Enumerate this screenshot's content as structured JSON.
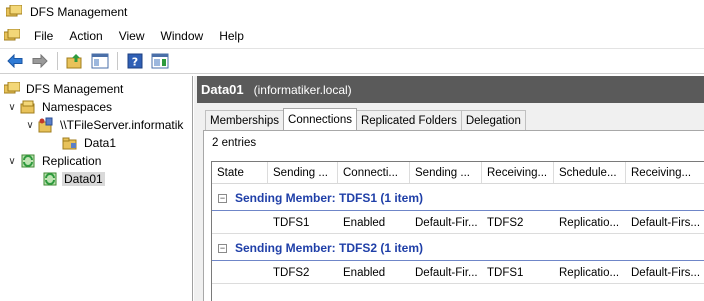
{
  "window": {
    "title": "DFS Management"
  },
  "menu": {
    "items": [
      "File",
      "Action",
      "View",
      "Window",
      "Help"
    ]
  },
  "toolbar": {
    "buttons": [
      "back-arrow-icon",
      "forward-arrow-icon",
      "up-folder-icon",
      "show-hide-tree-icon",
      "help-icon",
      "action-pane-icon"
    ]
  },
  "tree": {
    "root": "DFS Management",
    "namespaces": "Namespaces",
    "namespace_server": "\\\\TFileServer.informatik",
    "namespace_folder": "Data1",
    "replication": "Replication",
    "replication_group": "Data01"
  },
  "details": {
    "header_node": "Data01",
    "header_domain": "(informatiker.local)",
    "tabs": [
      "Memberships",
      "Connections",
      "Replicated Folders",
      "Delegation"
    ],
    "active_tab": "Connections",
    "entries": "2 entries",
    "columns": [
      "State",
      "Sending ...",
      "Connecti...",
      "Sending ...",
      "Receiving...",
      "Schedule...",
      "Receiving..."
    ],
    "groups": [
      {
        "title": "Sending Member: TDFS1 (1 item)",
        "rows": [
          [
            "",
            "TDFS1",
            "Enabled",
            "Default-Fir...",
            "TDFS2",
            "Replicatio...",
            "Default-Firs..."
          ]
        ]
      },
      {
        "title": "Sending Member: TDFS2 (1 item)",
        "rows": [
          [
            "",
            "TDFS2",
            "Enabled",
            "Default-Fir...",
            "TDFS1",
            "Replicatio...",
            "Default-Firs..."
          ]
        ]
      }
    ]
  }
}
